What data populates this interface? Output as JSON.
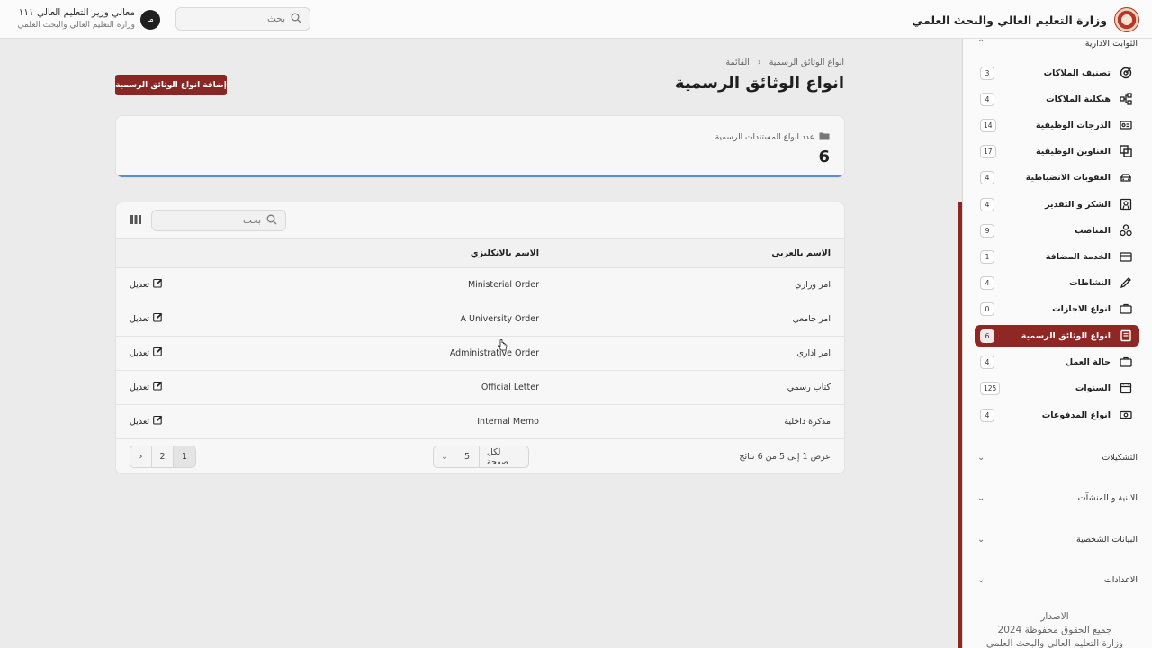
{
  "header": {
    "brand_title": "وزارة التعليم العالي والبحث العلمي",
    "search_placeholder": "بحث",
    "avatar_initials": "ما",
    "user_name": "معالي وزير التعليم العالي ١١١",
    "user_org": "وزارة التعليم العالي والبحث العلمي"
  },
  "sidebar": {
    "section_title": "الثوابت الادارية",
    "items": [
      {
        "label": "تصنيف الملاكات",
        "count": "3",
        "icon": "target-icon"
      },
      {
        "label": "هيكلية الملاكات",
        "count": "4",
        "icon": "hierarchy-icon"
      },
      {
        "label": "الدرجات الوظيفية",
        "count": "14",
        "icon": "id-card-icon"
      },
      {
        "label": "العناوين الوظيفية",
        "count": "17",
        "icon": "copy-icon"
      },
      {
        "label": "العقوبات الانضباطية",
        "count": "4",
        "icon": "car-icon"
      },
      {
        "label": "الشكر و التقدير",
        "count": "4",
        "icon": "certificate-icon"
      },
      {
        "label": "المناصب",
        "count": "9",
        "icon": "circles-icon"
      },
      {
        "label": "الخدمة المضافة",
        "count": "1",
        "icon": "wallet-icon"
      },
      {
        "label": "النشاطات",
        "count": "4",
        "icon": "pencil-icon"
      },
      {
        "label": "انواع الاجازات",
        "count": "0",
        "icon": "briefcase-icon"
      },
      {
        "label": "انواع الوثائق الرسمية",
        "count": "6",
        "icon": "document-icon",
        "active": true
      },
      {
        "label": "حالة العمل",
        "count": "4",
        "icon": "briefcase-icon"
      },
      {
        "label": "السنوات",
        "count": "125",
        "icon": "calendar-icon"
      },
      {
        "label": "انواع المدفوعات",
        "count": "4",
        "icon": "money-icon"
      }
    ],
    "groups": [
      "التشكيلات",
      "الابنية و المنشآت",
      "البيانات الشخصية",
      "الاعدادات"
    ],
    "footer_version": "الاصدار",
    "footer_rights": "جميع الحقوق محفوظة 2024",
    "footer_org": "وزارة التعليم العالي والبحث العلمي"
  },
  "breadcrumb": {
    "home": "القائمة",
    "current": "انواع الوثائق الرسمية"
  },
  "page": {
    "title": "انواع الوثائق الرسمية",
    "add_button": "إضافة انواع الوثائق الرسمية"
  },
  "stat": {
    "label": "عدد انواع المستندات الرسمية",
    "value": "6"
  },
  "table": {
    "search_placeholder": "بحث",
    "headers": {
      "arabic": "الاسم بالعربي",
      "english": "الاسم بالانكليزي"
    },
    "edit_label": "تعديل",
    "rows": [
      {
        "ar": "امر وزاري",
        "en": "Ministerial Order"
      },
      {
        "ar": "امر جامعي",
        "en": "A University Order"
      },
      {
        "ar": "امر اداري",
        "en": "Administrative Order"
      },
      {
        "ar": "كتاب رسمي",
        "en": "Official Letter"
      },
      {
        "ar": "مذكرة داخلية",
        "en": "Internal Memo"
      }
    ],
    "pagination_info": "عرض 1 إلى 5 من 6 نتائج",
    "per_page_label": "لكل صفحة",
    "per_page_value": "5",
    "pages": [
      "1",
      "2"
    ],
    "current_page": "1"
  },
  "colors": {
    "brand": "#8f2724",
    "accent_line": "#5b8fc9"
  }
}
